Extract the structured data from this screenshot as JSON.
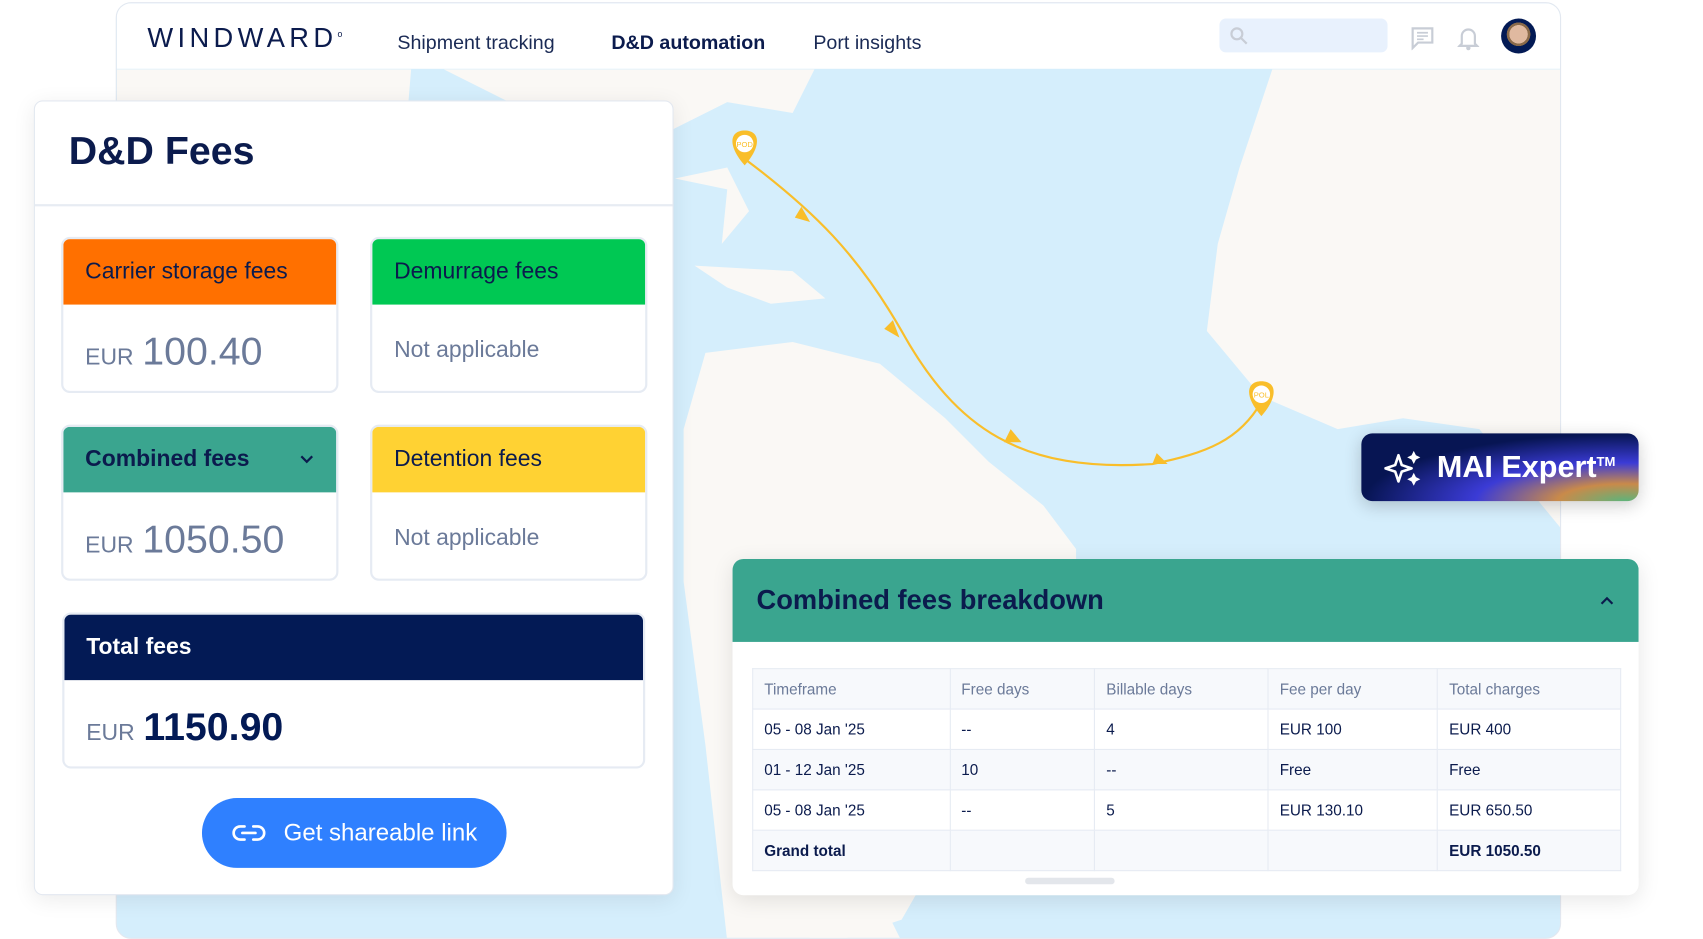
{
  "header": {
    "logo": "WINDWARD",
    "nav": [
      {
        "label": "Shipment tracking",
        "active": false
      },
      {
        "label": "D&D automation",
        "active": true
      },
      {
        "label": "Port insights",
        "active": false
      }
    ],
    "search_placeholder": "",
    "icons": [
      "search-icon",
      "chat-icon",
      "bell-icon",
      "avatar"
    ]
  },
  "map": {
    "pins": [
      {
        "label": "POD"
      },
      {
        "label": "POL"
      }
    ],
    "route_color": "#f9be2a"
  },
  "fees_panel": {
    "title": "D&D Fees",
    "cards": [
      {
        "title": "Carrier storage fees",
        "currency": "EUR",
        "value": "100.40",
        "color": "#ff7000"
      },
      {
        "title": "Demurrage fees",
        "value": "Not applicable",
        "color": "#00c853"
      },
      {
        "title": "Combined fees",
        "currency": "EUR",
        "value": "1050.50",
        "color": "#3aa58f",
        "expandable": true
      },
      {
        "title": "Detention fees",
        "value": "Not applicable",
        "color": "#ffd233"
      }
    ],
    "total": {
      "title": "Total fees",
      "currency": "EUR",
      "value": "1150.90",
      "color": "#031a55"
    },
    "share_button": "Get shareable link"
  },
  "mai_button": {
    "label": "MAI Expert",
    "tm": "TM"
  },
  "breakdown": {
    "title": "Combined fees breakdown",
    "columns": [
      "Timeframe",
      "Free days",
      "Billable days",
      "Fee per day",
      "Total charges"
    ],
    "rows": [
      [
        "05 - 08 Jan '25",
        "--",
        "4",
        "EUR 100",
        "EUR 400"
      ],
      [
        "01 - 12 Jan '25",
        "10",
        "--",
        "Free",
        "Free"
      ],
      [
        "05 - 08 Jan '25",
        "--",
        "5",
        "EUR 130.10",
        "EUR 650.50"
      ],
      [
        "Grand total",
        "",
        "",
        "",
        "EUR 1050.50"
      ]
    ]
  }
}
